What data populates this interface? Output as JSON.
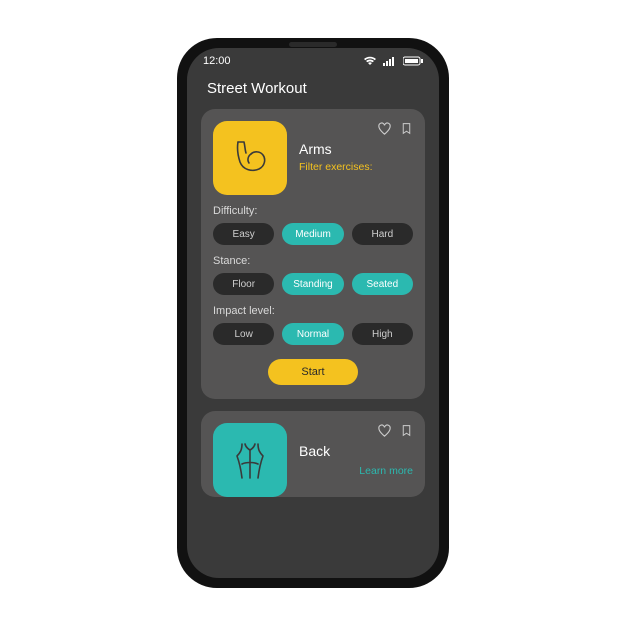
{
  "statusbar": {
    "time": "12:00"
  },
  "page_title": "Street Workout",
  "cards": {
    "arms": {
      "title": "Arms",
      "filter_label": "Filter exercises:",
      "filters": {
        "difficulty": {
          "label": "Difficulty:",
          "options": [
            "Easy",
            "Medium",
            "Hard"
          ],
          "active": [
            1
          ]
        },
        "stance": {
          "label": "Stance:",
          "options": [
            "Floor",
            "Standing",
            "Seated"
          ],
          "active": [
            1,
            2
          ]
        },
        "impact": {
          "label": "Impact level:",
          "options": [
            "Low",
            "Normal",
            "High"
          ],
          "active": [
            1
          ]
        }
      },
      "start_label": "Start"
    },
    "back": {
      "title": "Back",
      "learn_more": "Learn more"
    }
  },
  "colors": {
    "accent_yellow": "#f4c21f",
    "accent_teal": "#2bb9b0",
    "bg_dark": "#3a3a3a",
    "card_bg": "#555454",
    "chip_off": "#2a2a2a"
  }
}
